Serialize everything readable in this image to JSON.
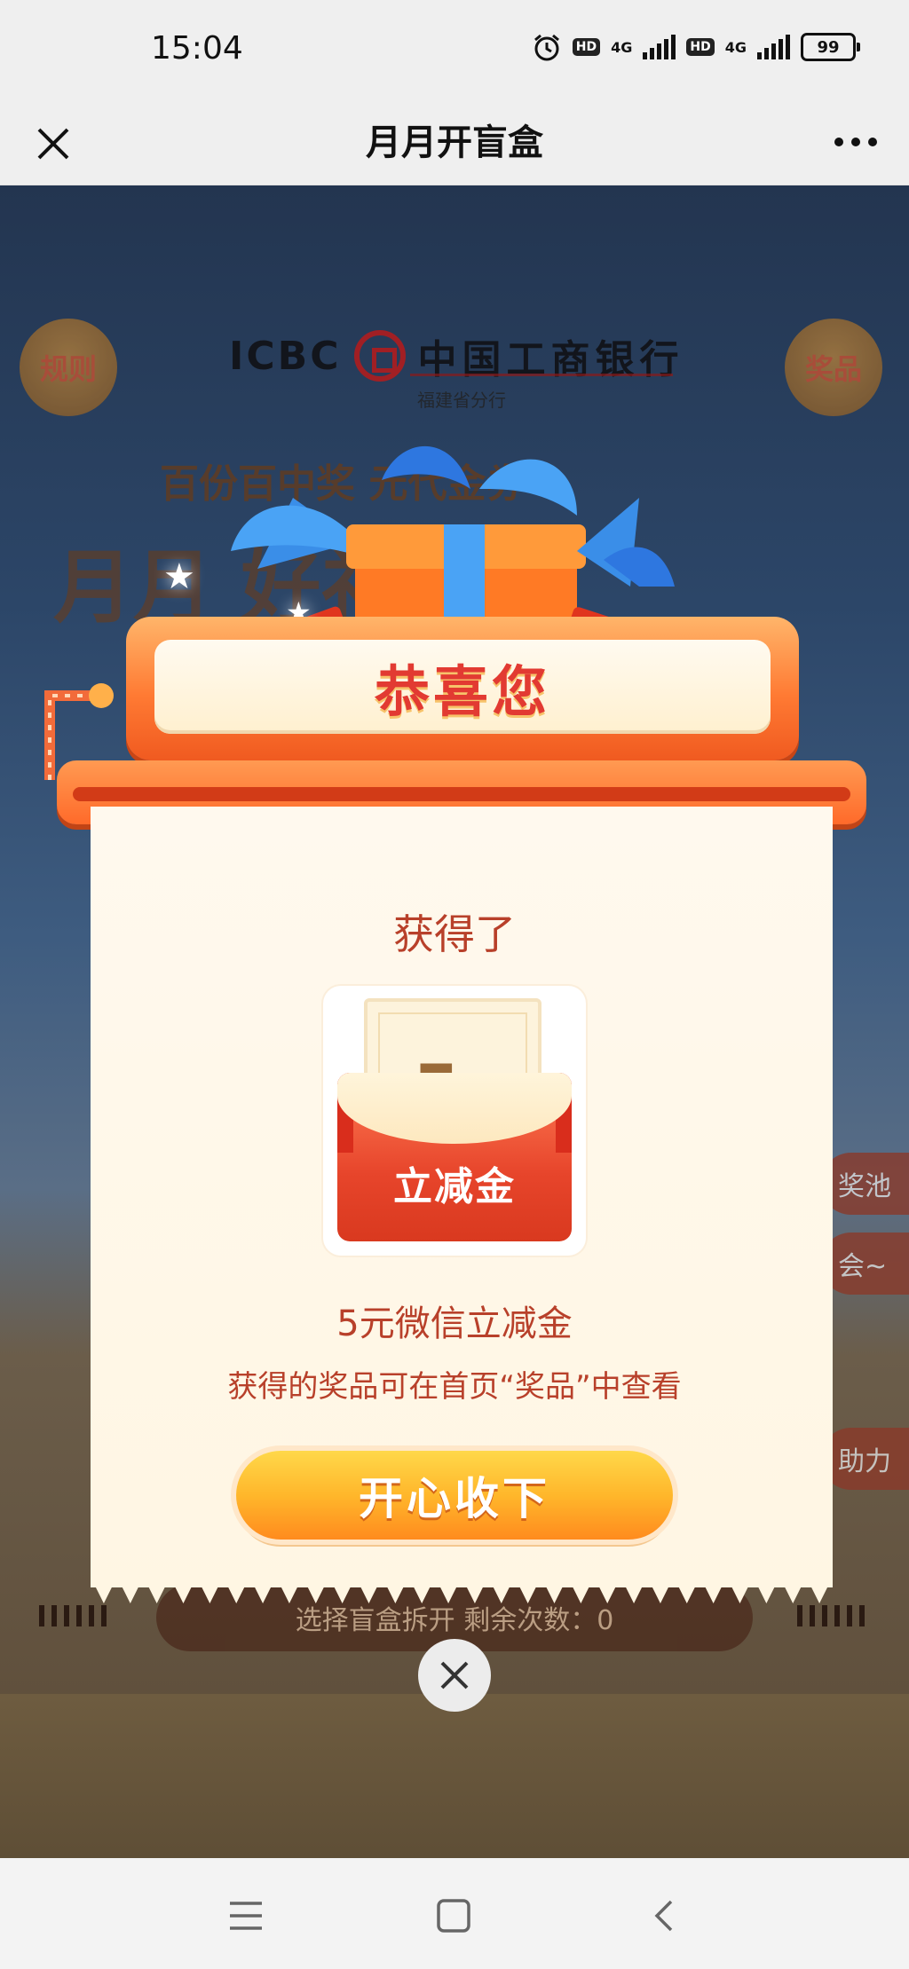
{
  "status_bar": {
    "time": "15:04",
    "hd1": "HD",
    "net1": "4G",
    "hd2": "HD",
    "net2": "4G",
    "battery": "99"
  },
  "nav": {
    "title": "月月开盲盒",
    "close_icon": "close-icon",
    "more_icon": "more-icon"
  },
  "background": {
    "rules_label": "规则",
    "prizes_label": "奖品",
    "bank_en": "ICBC",
    "bank_cn": "中国工商银行",
    "bank_branch": "福建省分行",
    "banner_sub": "百份百中奖  元代金券",
    "banner_main": "月月  好礼",
    "right_tab_1": "奖池",
    "right_tab_2": "会~",
    "right_tab_3": "助力",
    "bottom_status": "选择盲盒拆开 剩余次数：0"
  },
  "modal": {
    "header": "恭喜您",
    "won_label": "获得了",
    "coupon_amount": "5",
    "coupon_unit": "元",
    "coupon_type": "立减金",
    "prize_name": "5元微信立减金",
    "prize_tip": "获得的奖品可在首页“奖品”中查看",
    "accept_label": "开心收下",
    "close_icon": "close-icon"
  },
  "android_nav": {
    "menu_icon": "menu-icon",
    "home_icon": "home-icon",
    "back_icon": "back-icon"
  },
  "colors": {
    "accent_red": "#e23a32",
    "text_brown": "#b8402a",
    "button_orange": "#ffb72b"
  }
}
